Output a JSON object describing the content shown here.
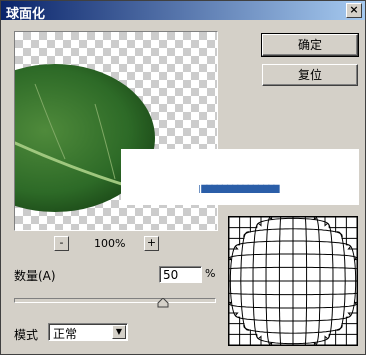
{
  "window": {
    "title": "球面化",
    "close_symbol": "×"
  },
  "buttons": {
    "ok": "确定",
    "reset": "复位"
  },
  "preview": {
    "zoom_minus": "-",
    "zoom_plus": "+",
    "zoom_value": "100%",
    "watermark_text": "| ▇▇▇▇▇▇▇▇▇▇▇▇▇▇▇"
  },
  "amount": {
    "label": "数量(A)",
    "value": "50",
    "unit": "%",
    "slider_level_percent": 50
  },
  "mode": {
    "label": "模式",
    "selected": "正常",
    "arrow": "▼"
  },
  "colors": {
    "titlebar_start": "#0a246a",
    "titlebar_end": "#a6caf0",
    "face": "#d4d0c8",
    "leaf": "#2f6b2a"
  }
}
